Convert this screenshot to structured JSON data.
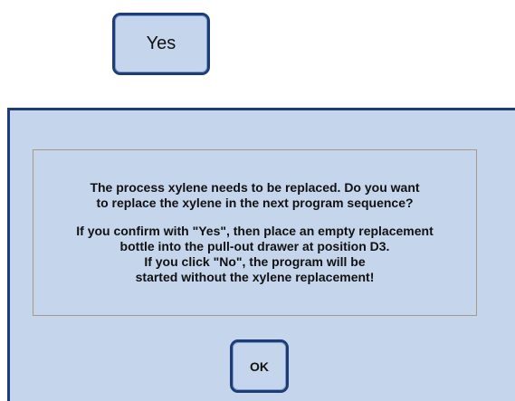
{
  "yes_button": {
    "label": "Yes"
  },
  "dialog": {
    "message_paragraph_1": [
      "The process xylene needs to be replaced. Do you want",
      "to replace the xylene in the next program sequence?"
    ],
    "message_paragraph_2": [
      "If you confirm with \"Yes\", then place an empty replacement",
      "bottle into the pull-out drawer at position D3.",
      "If you click \"No\", the program will be",
      "started without the xylene replacement!"
    ],
    "ok_label": "OK"
  },
  "colors": {
    "panel_background": "#c5d6ec",
    "border_dark_blue": "#1e3d78",
    "message_border": "#a5998c",
    "text": "#111111"
  }
}
